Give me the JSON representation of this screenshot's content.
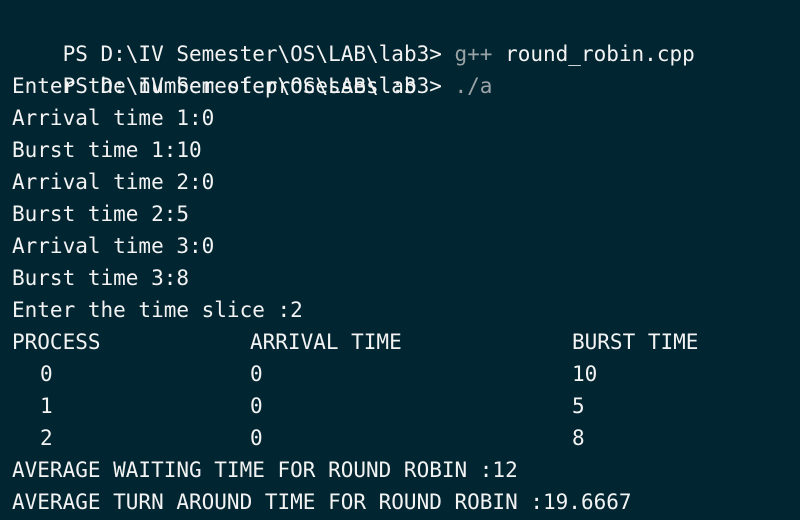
{
  "terminal": {
    "prompt1": "PS D:\\IV Semester\\OS\\LAB\\lab3> ",
    "cmd1_part1": "g++",
    "cmd1_part2": " round_robin.cpp",
    "prompt2": "PS D:\\IV Semester\\OS\\LAB\\lab3> ",
    "cmd2": "./a",
    "io_lines": [
      "Enter the number of processes :3",
      "Arrival time 1:0",
      "Burst time 1:10",
      "Arrival time 2:0",
      "Burst time 2:5",
      "Arrival time 3:0",
      "Burst time 3:8",
      "Enter the time slice :2"
    ],
    "table": {
      "headers": [
        "PROCESS",
        "ARRIVAL TIME",
        "BURST TIME"
      ],
      "rows": [
        [
          "0",
          "0",
          "10"
        ],
        [
          "1",
          "0",
          "5"
        ],
        [
          "2",
          "0",
          "8"
        ]
      ]
    },
    "avg_waiting": "AVERAGE WAITING TIME FOR ROUND ROBIN :12",
    "avg_turnaround": "AVERAGE TURN AROUND TIME FOR ROUND ROBIN :19.6667"
  },
  "colors": {
    "background": "#022631",
    "text": "#f3f3f3",
    "dim_text": "#9aa3a6"
  }
}
